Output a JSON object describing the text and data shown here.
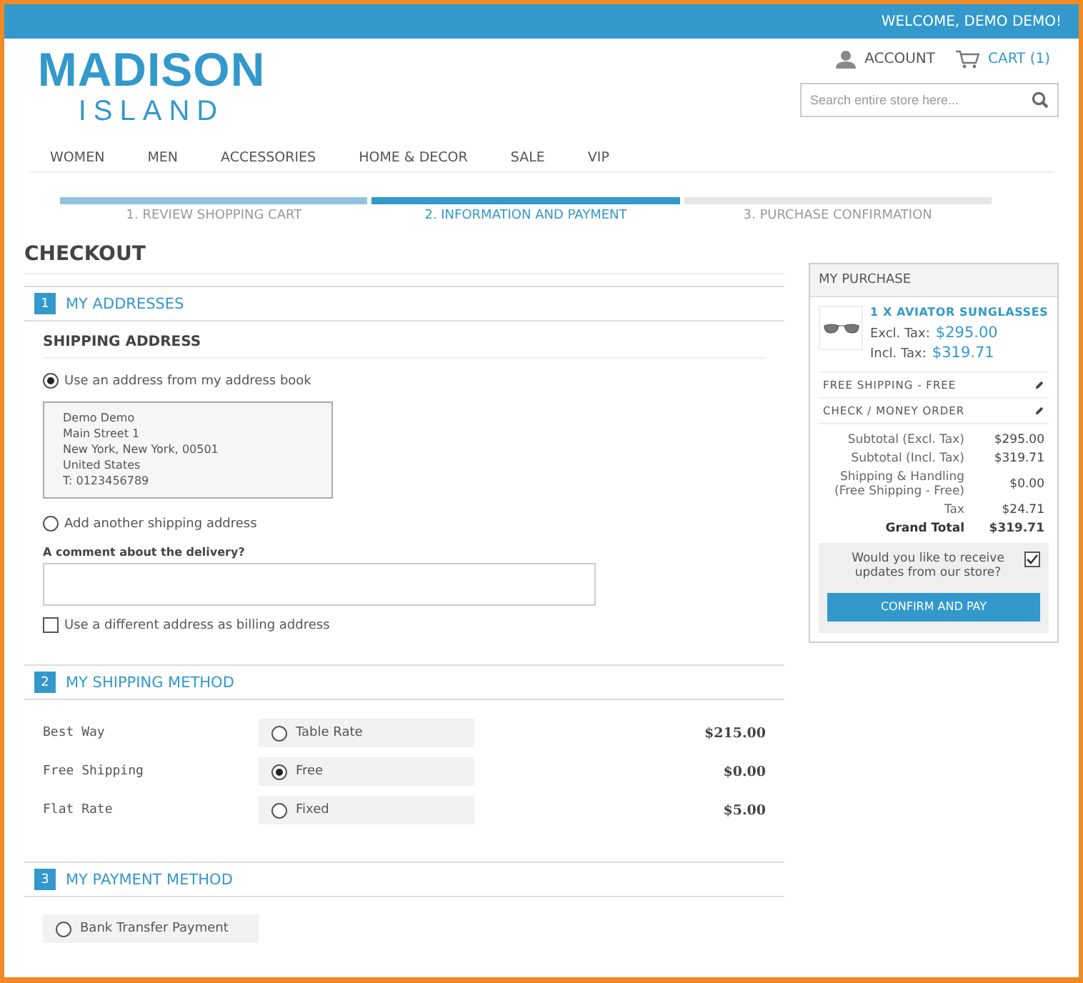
{
  "top_bar": {
    "welcome": "WELCOME, DEMO DEMO!"
  },
  "logo": {
    "line_1": "MADISON",
    "line_2": "ISLAND"
  },
  "header_links": [
    {
      "label": "ACCOUNT",
      "kind": "account"
    },
    {
      "label": "CART (1)",
      "kind": "cart"
    }
  ],
  "search": {
    "placeholder": "Search entire store here..."
  },
  "nav": [
    "WOMEN",
    "MEN",
    "ACCESSORIES",
    "HOME & DECOR",
    "SALE",
    "VIP"
  ],
  "steps": [
    {
      "number": "1.",
      "label": "REVIEW SHOPPING CART",
      "completed": true,
      "selected": false
    },
    {
      "number": "2.",
      "label": "INFORMATION AND PAYMENT",
      "completed": false,
      "selected": true
    },
    {
      "number": "3.",
      "label": "PURCHASE CONFIRMATION",
      "completed": false,
      "selected": false
    }
  ],
  "page_title": "CHECKOUT",
  "addresses": {
    "number": "1",
    "title": "MY ADDRESSES",
    "subtitle": "SHIPPING ADDRESS",
    "options": [
      {
        "label": "Use an address from my address book",
        "selected": true
      },
      {
        "label": "Add another shipping address",
        "selected": false
      }
    ],
    "address_lines": [
      "Demo Demo",
      "Main Street 1",
      "New York, New York, 00501",
      "United States",
      "T: 0123456789"
    ],
    "comment_label": "A comment about the delivery?",
    "billing": {
      "label": "Use a different address as billing address",
      "checked": false
    }
  },
  "shipping": {
    "number": "2",
    "title": "MY SHIPPING METHOD",
    "methods": [
      {
        "carrier": "Best Way",
        "option": "Table Rate",
        "price": "$215.00",
        "selected": false
      },
      {
        "carrier": "Free Shipping",
        "option": "Free",
        "price": "$0.00",
        "selected": true
      },
      {
        "carrier": "Flat Rate",
        "option": "Fixed",
        "price": "$5.00",
        "selected": false
      }
    ]
  },
  "payment": {
    "number": "3",
    "title": "MY PAYMENT METHOD",
    "methods": [
      {
        "label": "Bank Transfer Payment",
        "selected": false
      }
    ]
  },
  "purchase": {
    "title": "MY PURCHASE",
    "item": {
      "name": "1 X AVIATOR SUNGLASSES",
      "excl_label": "Excl. Tax:",
      "excl": "$295.00",
      "incl_label": "Incl. Tax:",
      "incl": "$319.71"
    },
    "choices": [
      "FREE SHIPPING - FREE",
      "CHECK / MONEY ORDER"
    ],
    "totals": [
      {
        "label": "Subtotal (Excl. Tax)",
        "value": "$295.00",
        "kind": "normal"
      },
      {
        "label": "Subtotal (Incl. Tax)",
        "value": "$319.71",
        "kind": "normal"
      },
      {
        "label": "Shipping & Handling (Free Shipping - Free)",
        "value": "$0.00",
        "kind": "normal"
      },
      {
        "label": "Tax",
        "value": "$24.71",
        "kind": "normal"
      },
      {
        "label": "Grand Total",
        "value": "$319.71",
        "kind": "grand"
      }
    ],
    "newsletter": {
      "label": "Would you like to receive updates from our store?",
      "checked": true
    },
    "button": "CONFIRM AND PAY"
  }
}
